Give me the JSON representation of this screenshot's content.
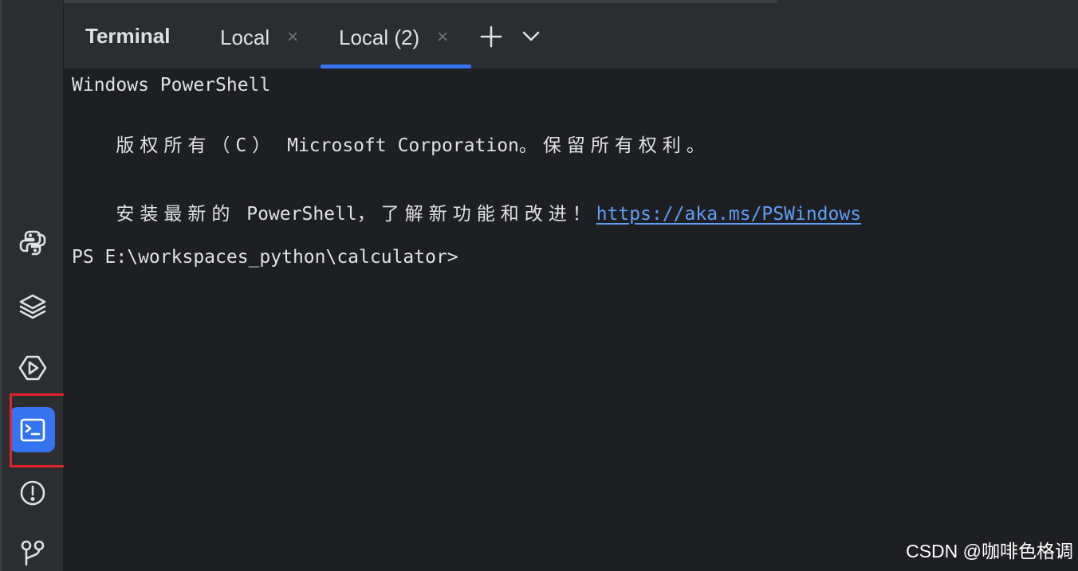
{
  "tool_window": {
    "title": "Terminal",
    "tabs": [
      {
        "label": "Local",
        "close": "×",
        "active": false
      },
      {
        "label": "Local (2)",
        "close": "×",
        "active": true
      }
    ],
    "new_tab_icon": "plus-icon",
    "dropdown_icon": "chevron-down-icon"
  },
  "sidebar": {
    "tools": [
      {
        "name": "python-console-icon",
        "active": false
      },
      {
        "name": "python-packages-icon",
        "active": false
      },
      {
        "name": "services-icon",
        "active": false
      },
      {
        "name": "terminal-icon",
        "active": true
      },
      {
        "name": "problems-icon",
        "active": false
      },
      {
        "name": "git-icon",
        "active": false
      }
    ]
  },
  "terminal": {
    "line1": "Windows PowerShell",
    "line2_cjk": "版权所有（C）",
    "line2_rest": " Microsoft Corporation",
    "line2_tail": "。保留所有权利。",
    "line3_cjk_a": "安装最新的",
    "line3_mid": " PowerShell",
    "line3_cjk_b": "，了解新功能和改进！",
    "line3_link": "https://aka.ms/PSWindows",
    "prompt": "PS E:\\workspaces_python\\calculator>"
  },
  "watermark": "CSDN @咖啡色格调",
  "colors": {
    "accent": "#3574f0",
    "background": "#1e1f22",
    "panel": "#2b2d30",
    "highlight": "#e0242b",
    "link": "#5e9ff5"
  }
}
